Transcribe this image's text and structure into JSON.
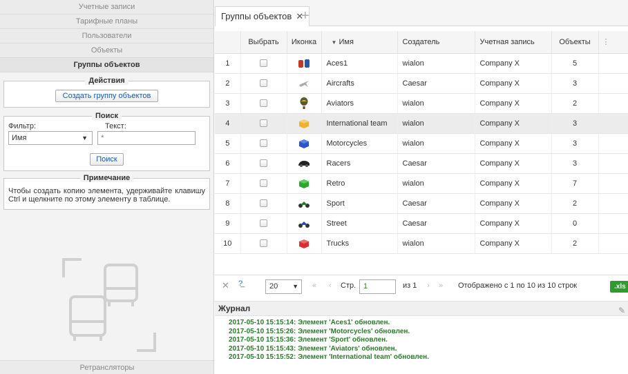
{
  "sidebar": {
    "nav": [
      "Учетные записи",
      "Тарифные планы",
      "Пользователи",
      "Объекты",
      "Группы объектов"
    ],
    "actions": {
      "legend": "Действия",
      "create_button": "Создать группу объектов"
    },
    "search": {
      "legend": "Поиск",
      "filter_label": "Фильтр:",
      "text_label": "Текст:",
      "filter_value": "Имя",
      "text_value": "*",
      "search_button": "Поиск"
    },
    "note": {
      "legend": "Примечание",
      "text": "Чтобы создать копию элемента, удерживайте клавишу Ctrl и щелкните по этому элементу в таблице."
    },
    "bottom_item": "Ретрансляторы"
  },
  "tabs": {
    "active_label": "Группы объектов",
    "close": "✕",
    "add": "+"
  },
  "table": {
    "headers": {
      "select": "Выбрать",
      "icon": "Иконка",
      "name": "Имя",
      "creator": "Создатель",
      "account": "Учетная запись",
      "objects": "Объекты"
    },
    "sort_indicator": "▼",
    "rows": [
      {
        "n": "1",
        "icon": "cars-pair-icon",
        "name": "Aces1",
        "creator": "wialon",
        "account": "Company X",
        "objects": "5"
      },
      {
        "n": "2",
        "icon": "aircraft-icon",
        "name": "Aircrafts",
        "creator": "Caesar",
        "account": "Company X",
        "objects": "3"
      },
      {
        "n": "3",
        "icon": "balloon-icon",
        "name": "Aviators",
        "creator": "wialon",
        "account": "Company X",
        "objects": "2"
      },
      {
        "n": "4",
        "icon": "yellow-box-icon",
        "name": "International team",
        "creator": "wialon",
        "account": "Company X",
        "objects": "3"
      },
      {
        "n": "5",
        "icon": "blue-box-icon",
        "name": "Motorcycles",
        "creator": "wialon",
        "account": "Company X",
        "objects": "3"
      },
      {
        "n": "6",
        "icon": "black-car-icon",
        "name": "Racers",
        "creator": "Caesar",
        "account": "Company X",
        "objects": "3"
      },
      {
        "n": "7",
        "icon": "green-box-icon",
        "name": "Retro",
        "creator": "wialon",
        "account": "Company X",
        "objects": "7"
      },
      {
        "n": "8",
        "icon": "motorbike-icon",
        "name": "Sport",
        "creator": "Caesar",
        "account": "Company X",
        "objects": "2"
      },
      {
        "n": "9",
        "icon": "motorbike-blue-icon",
        "name": "Street",
        "creator": "Caesar",
        "account": "Company X",
        "objects": "0"
      },
      {
        "n": "10",
        "icon": "red-box-icon",
        "name": "Trucks",
        "creator": "wialon",
        "account": "Company X",
        "objects": "2"
      }
    ]
  },
  "pager": {
    "page_size": "20",
    "page_label": "Стр.",
    "page_value": "1",
    "of_label": "из 1",
    "summary": "Отображено с 1 по 10 из 10 строк",
    "export": ".xls"
  },
  "log": {
    "title": "Журнал",
    "entries": [
      "2017-05-10 15:15:14: Элемент 'Aces1' обновлен.",
      "2017-05-10 15:15:26: Элемент 'Motorcycles' обновлен.",
      "2017-05-10 15:15:36: Элемент 'Sport' обновлен.",
      "2017-05-10 15:15:43: Элемент 'Aviators' обновлен.",
      "2017-05-10 15:15:52: Элемент 'International team' обновлен."
    ]
  }
}
